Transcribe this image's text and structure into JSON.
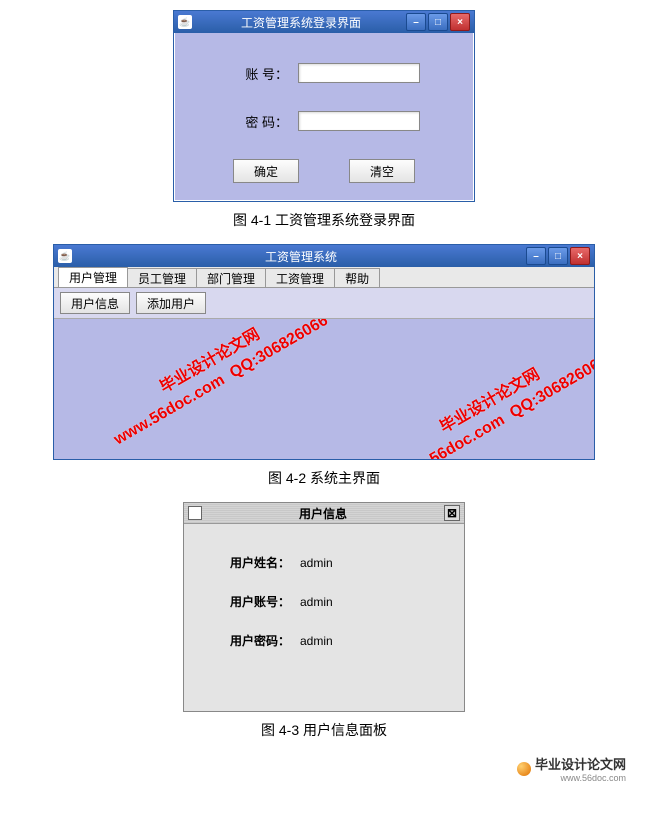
{
  "figure1": {
    "window_title": "工资管理系统登录界面",
    "account_label": "账 号：",
    "password_label": "密 码：",
    "account_value": "",
    "password_value": "",
    "ok_btn": "确定",
    "clear_btn": "清空",
    "caption": "图 4-1 工资管理系统登录界面"
  },
  "figure2": {
    "window_title": "工资管理系统",
    "tabs": [
      "用户管理",
      "员工管理",
      "部门管理",
      "工资管理",
      "帮助"
    ],
    "toolbar": [
      "用户信息",
      "添加用户"
    ],
    "watermark_text": "毕业设计论文网\nwww.56doc.com  QQ:306826066",
    "caption": "图 4-2 系统主界面"
  },
  "figure3": {
    "window_title": "用户信息",
    "rows": [
      {
        "label": "用户姓名：",
        "value": "admin"
      },
      {
        "label": "用户账号：",
        "value": "admin"
      },
      {
        "label": "用户密码：",
        "value": "admin"
      }
    ],
    "caption": "图 4-3 用户信息面板"
  },
  "footer": {
    "brand": "毕业设计论文网",
    "url": "www.56doc.com"
  }
}
